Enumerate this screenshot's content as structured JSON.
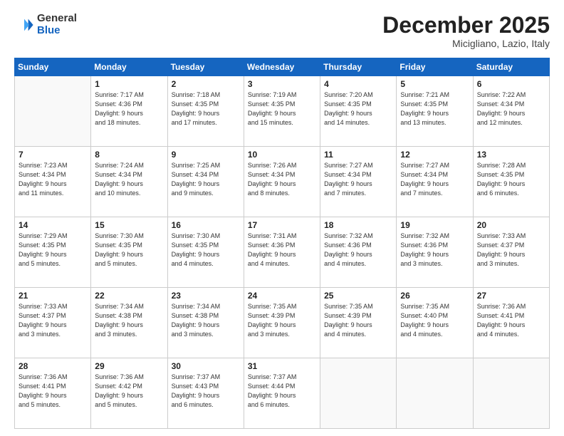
{
  "header": {
    "logo_general": "General",
    "logo_blue": "Blue",
    "title": "December 2025",
    "subtitle": "Micigliano, Lazio, Italy"
  },
  "weekdays": [
    "Sunday",
    "Monday",
    "Tuesday",
    "Wednesday",
    "Thursday",
    "Friday",
    "Saturday"
  ],
  "weeks": [
    [
      {
        "day": "",
        "info": ""
      },
      {
        "day": "1",
        "info": "Sunrise: 7:17 AM\nSunset: 4:36 PM\nDaylight: 9 hours\nand 18 minutes."
      },
      {
        "day": "2",
        "info": "Sunrise: 7:18 AM\nSunset: 4:35 PM\nDaylight: 9 hours\nand 17 minutes."
      },
      {
        "day": "3",
        "info": "Sunrise: 7:19 AM\nSunset: 4:35 PM\nDaylight: 9 hours\nand 15 minutes."
      },
      {
        "day": "4",
        "info": "Sunrise: 7:20 AM\nSunset: 4:35 PM\nDaylight: 9 hours\nand 14 minutes."
      },
      {
        "day": "5",
        "info": "Sunrise: 7:21 AM\nSunset: 4:35 PM\nDaylight: 9 hours\nand 13 minutes."
      },
      {
        "day": "6",
        "info": "Sunrise: 7:22 AM\nSunset: 4:34 PM\nDaylight: 9 hours\nand 12 minutes."
      }
    ],
    [
      {
        "day": "7",
        "info": "Sunrise: 7:23 AM\nSunset: 4:34 PM\nDaylight: 9 hours\nand 11 minutes."
      },
      {
        "day": "8",
        "info": "Sunrise: 7:24 AM\nSunset: 4:34 PM\nDaylight: 9 hours\nand 10 minutes."
      },
      {
        "day": "9",
        "info": "Sunrise: 7:25 AM\nSunset: 4:34 PM\nDaylight: 9 hours\nand 9 minutes."
      },
      {
        "day": "10",
        "info": "Sunrise: 7:26 AM\nSunset: 4:34 PM\nDaylight: 9 hours\nand 8 minutes."
      },
      {
        "day": "11",
        "info": "Sunrise: 7:27 AM\nSunset: 4:34 PM\nDaylight: 9 hours\nand 7 minutes."
      },
      {
        "day": "12",
        "info": "Sunrise: 7:27 AM\nSunset: 4:34 PM\nDaylight: 9 hours\nand 7 minutes."
      },
      {
        "day": "13",
        "info": "Sunrise: 7:28 AM\nSunset: 4:35 PM\nDaylight: 9 hours\nand 6 minutes."
      }
    ],
    [
      {
        "day": "14",
        "info": "Sunrise: 7:29 AM\nSunset: 4:35 PM\nDaylight: 9 hours\nand 5 minutes."
      },
      {
        "day": "15",
        "info": "Sunrise: 7:30 AM\nSunset: 4:35 PM\nDaylight: 9 hours\nand 5 minutes."
      },
      {
        "day": "16",
        "info": "Sunrise: 7:30 AM\nSunset: 4:35 PM\nDaylight: 9 hours\nand 4 minutes."
      },
      {
        "day": "17",
        "info": "Sunrise: 7:31 AM\nSunset: 4:36 PM\nDaylight: 9 hours\nand 4 minutes."
      },
      {
        "day": "18",
        "info": "Sunrise: 7:32 AM\nSunset: 4:36 PM\nDaylight: 9 hours\nand 4 minutes."
      },
      {
        "day": "19",
        "info": "Sunrise: 7:32 AM\nSunset: 4:36 PM\nDaylight: 9 hours\nand 3 minutes."
      },
      {
        "day": "20",
        "info": "Sunrise: 7:33 AM\nSunset: 4:37 PM\nDaylight: 9 hours\nand 3 minutes."
      }
    ],
    [
      {
        "day": "21",
        "info": "Sunrise: 7:33 AM\nSunset: 4:37 PM\nDaylight: 9 hours\nand 3 minutes."
      },
      {
        "day": "22",
        "info": "Sunrise: 7:34 AM\nSunset: 4:38 PM\nDaylight: 9 hours\nand 3 minutes."
      },
      {
        "day": "23",
        "info": "Sunrise: 7:34 AM\nSunset: 4:38 PM\nDaylight: 9 hours\nand 3 minutes."
      },
      {
        "day": "24",
        "info": "Sunrise: 7:35 AM\nSunset: 4:39 PM\nDaylight: 9 hours\nand 3 minutes."
      },
      {
        "day": "25",
        "info": "Sunrise: 7:35 AM\nSunset: 4:39 PM\nDaylight: 9 hours\nand 4 minutes."
      },
      {
        "day": "26",
        "info": "Sunrise: 7:35 AM\nSunset: 4:40 PM\nDaylight: 9 hours\nand 4 minutes."
      },
      {
        "day": "27",
        "info": "Sunrise: 7:36 AM\nSunset: 4:41 PM\nDaylight: 9 hours\nand 4 minutes."
      }
    ],
    [
      {
        "day": "28",
        "info": "Sunrise: 7:36 AM\nSunset: 4:41 PM\nDaylight: 9 hours\nand 5 minutes."
      },
      {
        "day": "29",
        "info": "Sunrise: 7:36 AM\nSunset: 4:42 PM\nDaylight: 9 hours\nand 5 minutes."
      },
      {
        "day": "30",
        "info": "Sunrise: 7:37 AM\nSunset: 4:43 PM\nDaylight: 9 hours\nand 6 minutes."
      },
      {
        "day": "31",
        "info": "Sunrise: 7:37 AM\nSunset: 4:44 PM\nDaylight: 9 hours\nand 6 minutes."
      },
      {
        "day": "",
        "info": ""
      },
      {
        "day": "",
        "info": ""
      },
      {
        "day": "",
        "info": ""
      }
    ]
  ]
}
